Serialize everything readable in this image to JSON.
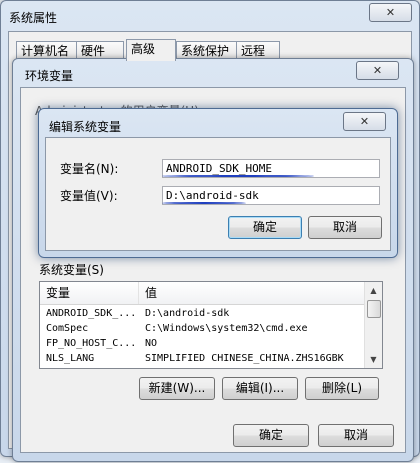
{
  "sysprops": {
    "title": "系统属性",
    "tabs": [
      "计算机名",
      "硬件",
      "高级",
      "系统保护",
      "远程"
    ],
    "active_tab": 2
  },
  "envvars": {
    "title": "环境变量",
    "user_vars_label": "Administrator 的用户变量(U)",
    "system_vars_label": "系统变量(S)",
    "columns": [
      "变量",
      "值"
    ],
    "rows": [
      {
        "name": "ANDROID_SDK_...",
        "value": "D:\\android-sdk"
      },
      {
        "name": "ComSpec",
        "value": "C:\\Windows\\system32\\cmd.exe"
      },
      {
        "name": "FP_NO_HOST_C...",
        "value": "NO"
      },
      {
        "name": "NLS_LANG",
        "value": "SIMPLIFIED CHINESE_CHINA.ZHS16GBK"
      }
    ],
    "new_btn": "新建(W)...",
    "edit_btn": "编辑(I)...",
    "delete_btn": "删除(L)",
    "ok_btn": "确定",
    "cancel_btn": "取消"
  },
  "editdlg": {
    "title": "编辑系统变量",
    "name_label": "变量名(N):",
    "value_label": "变量值(V):",
    "name_value": "ANDROID_SDK_HOME",
    "value_value": "D:\\android-sdk",
    "ok_btn": "确定",
    "cancel_btn": "取消"
  },
  "colors": {
    "annotation": "#1f3fbf",
    "window_frame": "#c8d7ea",
    "face": "#f0f0f0"
  }
}
